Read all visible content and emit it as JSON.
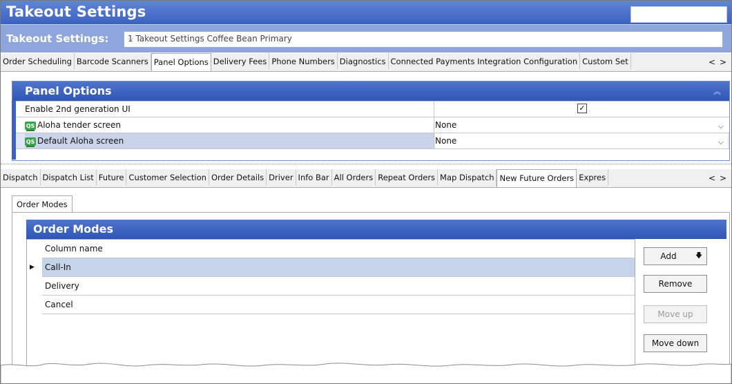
{
  "window": {
    "title": "Takeout Settings"
  },
  "settings_selector": {
    "label": "Takeout Settings:",
    "value": "1 Takeout Settings Coffee Bean Primary"
  },
  "top_tabs": {
    "items": [
      "Order Scheduling",
      "Barcode Scanners",
      "Panel Options",
      "Delivery Fees",
      "Phone Numbers",
      "Diagnostics",
      "Connected Payments Integration Configuration",
      "Custom Set"
    ],
    "active": "Panel Options"
  },
  "panel_options": {
    "header": "Panel Options",
    "rows": [
      {
        "label": "Enable 2nd generation UI",
        "value": "",
        "checked": true,
        "icon": false
      },
      {
        "label": "Aloha tender screen",
        "value": "None",
        "icon": true
      },
      {
        "label": "Default Aloha screen",
        "value": "None",
        "icon": true
      }
    ]
  },
  "sub_tabs": {
    "items": [
      "Dispatch",
      "Dispatch List",
      "Future",
      "Customer Selection",
      "Order Details",
      "Driver",
      "Info Bar",
      "All Orders",
      "Repeat Orders",
      "Map Dispatch",
      "New Future Orders",
      "Expres"
    ],
    "active": "New Future Orders"
  },
  "inner_tabs": {
    "items": [
      "Order Modes"
    ],
    "active": "Order Modes"
  },
  "order_modes": {
    "header": "Order Modes",
    "column_header": "Column name",
    "rows": [
      "Call-In",
      "Delivery",
      "Cancel"
    ],
    "selected": "Call-In"
  },
  "buttons": {
    "add": "Add",
    "remove": "Remove",
    "move_up": "Move up",
    "move_down": "Move down"
  },
  "icons": {
    "qs": "qs-icon",
    "tab_scroll_left": "chevron-left-icon",
    "tab_scroll_right": "chevron-right-icon"
  },
  "colors": {
    "title_bar": "#3b62c0",
    "panel_header": "#2f56b6",
    "selected_row": "#c5d4e8"
  }
}
